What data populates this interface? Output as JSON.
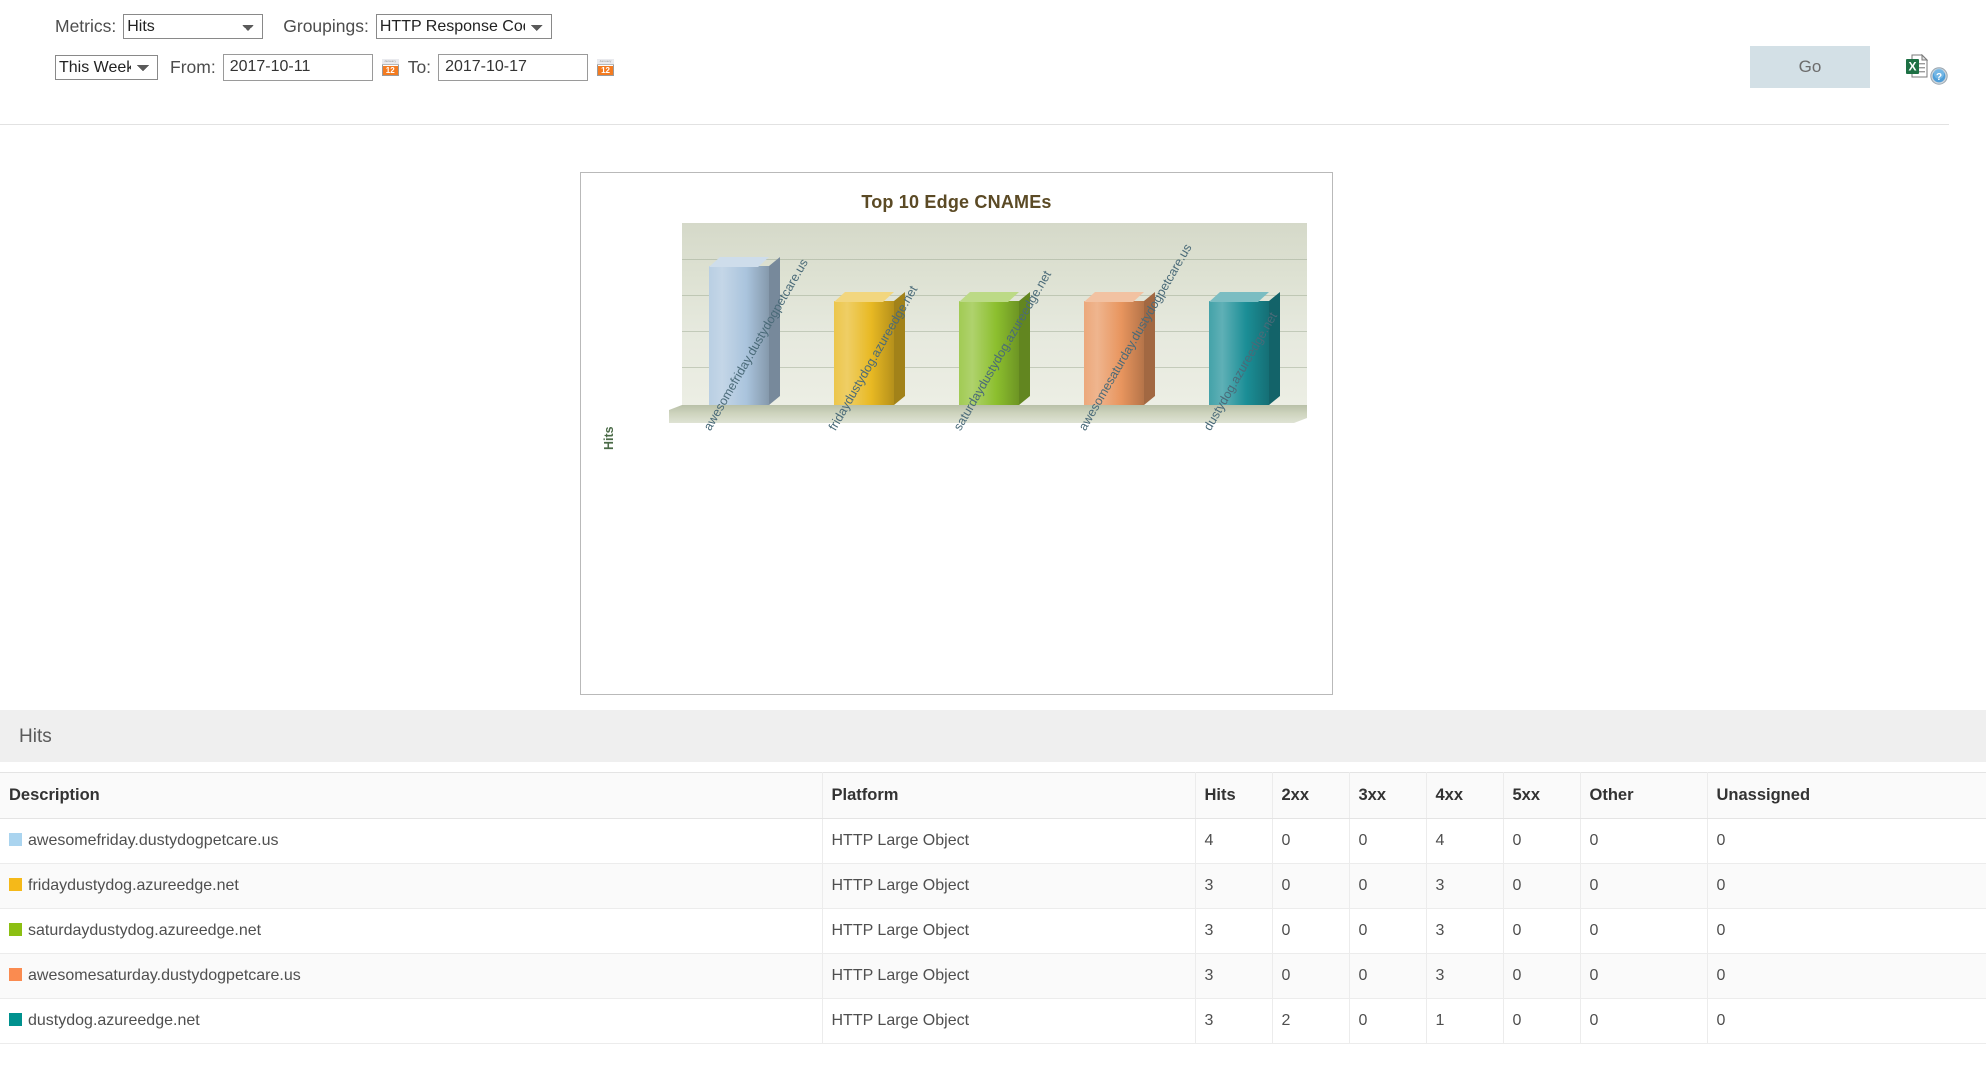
{
  "toolbar": {
    "metrics_label": "Metrics:",
    "metrics_value": "Hits",
    "metrics_options": [
      "Hits"
    ],
    "groupings_label": "Groupings:",
    "groupings_value": "HTTP Response Codes",
    "groupings_options": [
      "HTTP Response Codes"
    ],
    "range_value": "This Week",
    "range_options": [
      "This Week"
    ],
    "from_label": "From:",
    "from_value": "2017-10-11",
    "to_label": "To:",
    "to_value": "2017-10-17",
    "go_label": "Go",
    "calendar_icon_name": "calendar-icon",
    "calendar_icon_month": "January",
    "calendar_icon_day": "12",
    "excel_icon_name": "excel-export-icon",
    "help_icon_name": "help-icon",
    "help_icon_glyph": "?"
  },
  "chart_data": {
    "type": "bar",
    "title": "Top 10 Edge CNAMEs",
    "xlabel": "",
    "ylabel": "Hits",
    "ylim": [
      0,
      5
    ],
    "grid": true,
    "legend_position": "none",
    "categories": [
      "awesomefriday.dustydogpetcare.us",
      "fridaydustydog.azureedge.net",
      "saturdaydustydog.azureedge.net",
      "awesomesaturday.dustydogpetcare.us",
      "dustydog.azureedge.net"
    ],
    "values": [
      4,
      3,
      3,
      3,
      3
    ],
    "colors": [
      "#aac4dd",
      "#e8b923",
      "#8cbf2e",
      "#e8955e",
      "#1b8e96"
    ]
  },
  "table": {
    "section_title": "Hits",
    "columns": [
      "Description",
      "Platform",
      "Hits",
      "2xx",
      "3xx",
      "4xx",
      "5xx",
      "Other",
      "Unassigned"
    ],
    "rows": [
      {
        "swatch": "#aad4ef",
        "description": "awesomefriday.dustydogpetcare.us",
        "platform": "HTTP Large Object",
        "hits": "4",
        "c2xx": "0",
        "c3xx": "0",
        "c4xx": "4",
        "c5xx": "0",
        "other": "0",
        "unassigned": "0"
      },
      {
        "swatch": "#f5b919",
        "description": "fridaydustydog.azureedge.net",
        "platform": "HTTP Large Object",
        "hits": "3",
        "c2xx": "0",
        "c3xx": "0",
        "c4xx": "3",
        "c5xx": "0",
        "other": "0",
        "unassigned": "0"
      },
      {
        "swatch": "#8cbf13",
        "description": "saturdaydustydog.azureedge.net",
        "platform": "HTTP Large Object",
        "hits": "3",
        "c2xx": "0",
        "c3xx": "0",
        "c4xx": "3",
        "c5xx": "0",
        "other": "0",
        "unassigned": "0"
      },
      {
        "swatch": "#fa8b50",
        "description": "awesomesaturday.dustydogpetcare.us",
        "platform": "HTTP Large Object",
        "hits": "3",
        "c2xx": "0",
        "c3xx": "0",
        "c4xx": "3",
        "c5xx": "0",
        "other": "0",
        "unassigned": "0"
      },
      {
        "swatch": "#00918e",
        "description": "dustydog.azureedge.net",
        "platform": "HTTP Large Object",
        "hits": "3",
        "c2xx": "2",
        "c3xx": "0",
        "c4xx": "1",
        "c5xx": "0",
        "other": "0",
        "unassigned": "0"
      }
    ]
  }
}
